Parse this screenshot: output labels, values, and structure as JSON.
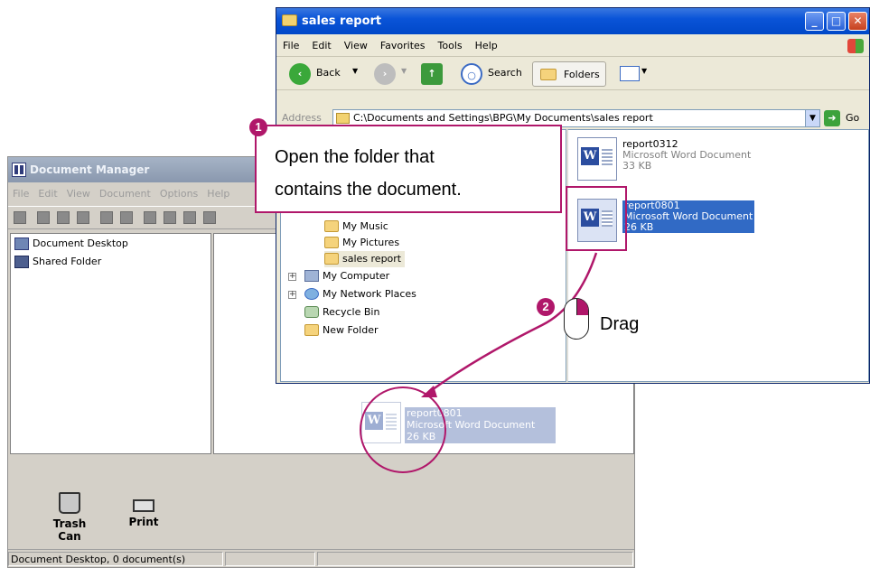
{
  "document_manager": {
    "title": "Document Manager",
    "menu": [
      "File",
      "Edit",
      "View",
      "Document",
      "Options",
      "Help"
    ],
    "tree": [
      {
        "label": "Document Desktop",
        "icon": "desktop-icon"
      },
      {
        "label": "Shared Folder",
        "icon": "shared-folder-icon"
      }
    ],
    "bottom_buttons": [
      {
        "label": "Trash Can",
        "icon": "trash-can-icon"
      },
      {
        "label": "Print",
        "icon": "printer-icon"
      }
    ],
    "status": "Document Desktop, 0 document(s)",
    "ghost_item": {
      "name": "report0801",
      "type": "Microsoft Word Document",
      "size": "26 KB"
    }
  },
  "explorer": {
    "title": "sales report",
    "menu": [
      "File",
      "Edit",
      "View",
      "Favorites",
      "Tools",
      "Help"
    ],
    "toolbar": {
      "back": "Back",
      "search": "Search",
      "folders": "Folders"
    },
    "address_label": "Address",
    "address_value": "C:\\Documents and Settings\\BPG\\My Documents\\sales report",
    "go_label": "Go",
    "tree": [
      {
        "label": "My Music",
        "icon": "music-folder-icon"
      },
      {
        "label": "My Pictures",
        "icon": "pictures-folder-icon"
      },
      {
        "label": "sales report",
        "icon": "folder-icon"
      },
      {
        "label": "My Computer",
        "icon": "computer-icon"
      },
      {
        "label": "My Network Places",
        "icon": "network-icon"
      },
      {
        "label": "Recycle Bin",
        "icon": "recycle-bin-icon"
      },
      {
        "label": "New Folder",
        "icon": "folder-icon"
      }
    ],
    "files": [
      {
        "name": "report0312",
        "type": "Microsoft Word Document",
        "size": "33 KB",
        "selected": false
      },
      {
        "name": "report0801",
        "type": "Microsoft Word Document",
        "size": "26 KB",
        "selected": true
      }
    ]
  },
  "callouts": {
    "step1_number": "1",
    "step1_line1": "Open the folder that",
    "step1_line2": "contains the document.",
    "step2_number": "2",
    "step2_text": "Drag"
  },
  "colors": {
    "callout": "#b0176a",
    "selection": "#316ac5",
    "xp_title": "#0a54d8"
  }
}
